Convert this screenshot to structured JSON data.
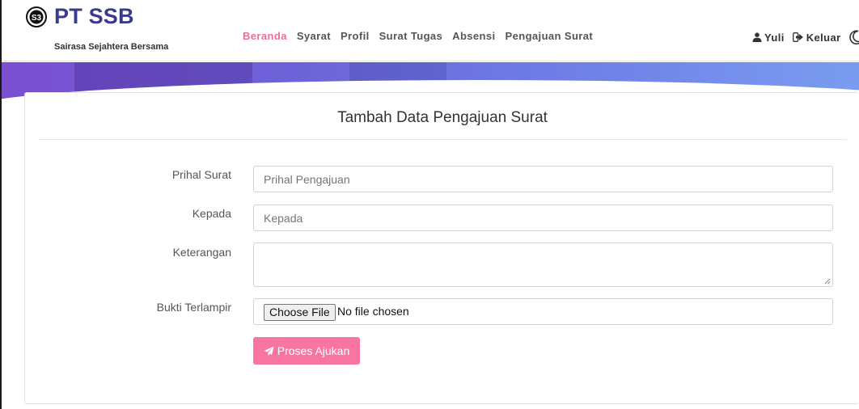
{
  "brand": {
    "name": "PT SSB",
    "subtitle": "Sairasa Sejahtera Bersama",
    "logo_text": "S3"
  },
  "nav": {
    "items": [
      {
        "label": "Beranda",
        "active": true
      },
      {
        "label": "Syarat",
        "active": false
      },
      {
        "label": "Profil",
        "active": false
      },
      {
        "label": "Surat Tugas",
        "active": false
      },
      {
        "label": "Absensi",
        "active": false
      },
      {
        "label": "Pengajuan Surat",
        "active": false
      }
    ],
    "user_label": "Yuli",
    "logout_label": "Keluar",
    "active_color": "#ee6c9a"
  },
  "form": {
    "title": "Tambah Data Pengajuan Surat",
    "fields": {
      "prihal": {
        "label": "Prihal Surat",
        "placeholder": "Prihal Pengajuan"
      },
      "kepada": {
        "label": "Kepada",
        "placeholder": "Kepada"
      },
      "keterangan": {
        "label": "Keterangan",
        "placeholder": ""
      },
      "bukti": {
        "label": "Bukti Terlampir",
        "button_label": "Choose File",
        "status": "No file chosen"
      }
    },
    "submit_label": "Proses Ajukan",
    "submit_color": "#f775a0"
  }
}
